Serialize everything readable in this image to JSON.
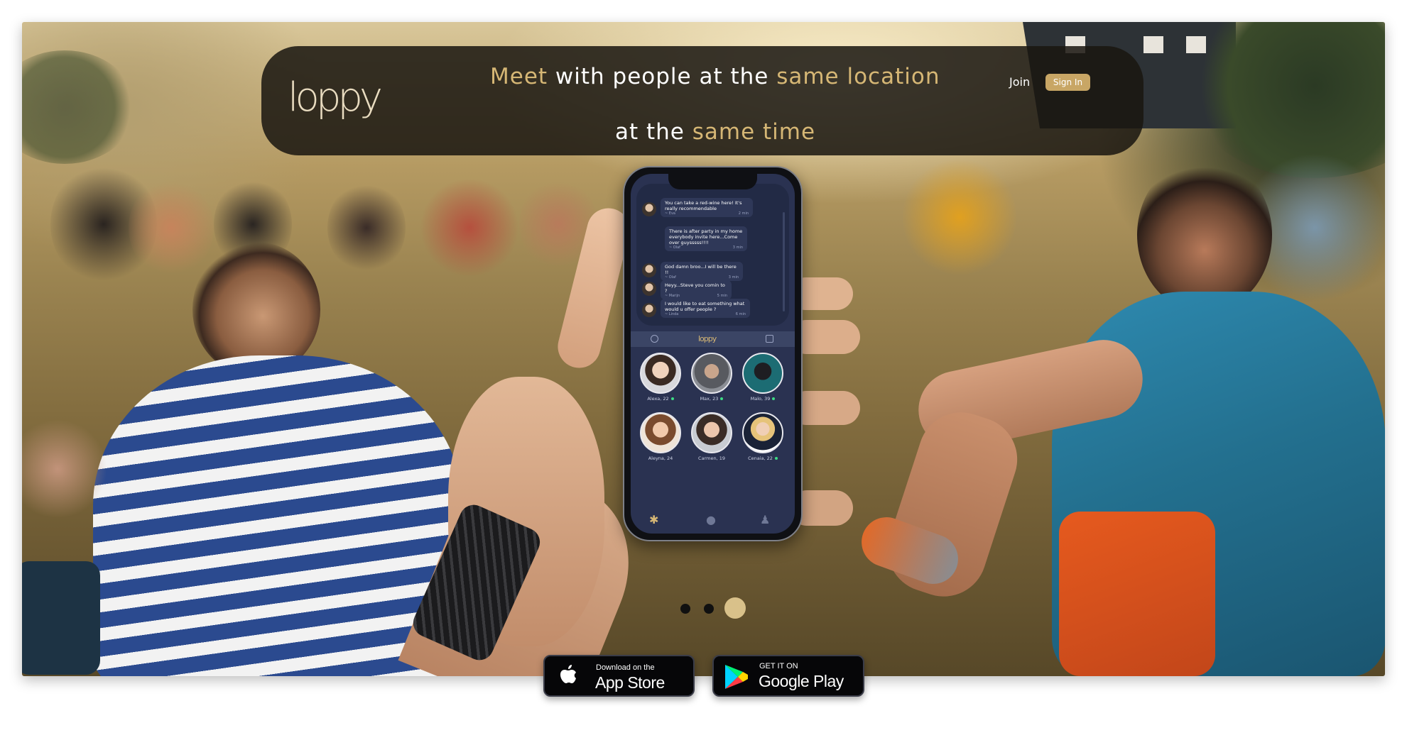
{
  "header": {
    "logo_text": "loppy",
    "tagline_line1": {
      "part1": "Meet",
      "part2": " with people at the ",
      "part3": "same location"
    },
    "tagline_line2": {
      "part1": "at the ",
      "part2": "same time"
    },
    "join_label": "Join",
    "signin_label": "Sign In"
  },
  "phone": {
    "app_logo": "loppy",
    "messages": [
      {
        "text": "You can take a red-wine here! It's really recommendable",
        "author": "~ Eva",
        "time": "2 min"
      },
      {
        "text": "There is after party in my home everybody invite here...Come over guysssss!!!!",
        "author": "~ Olaf",
        "time": "3 min"
      },
      {
        "text": "God damn broo...I will be there !!",
        "author": "~ Olaf",
        "time": "3 min"
      },
      {
        "text": "Heyy...Steve you comin to ?",
        "author": "~ Marijn",
        "time": "5 min"
      },
      {
        "text": "I would like to eat something what would u offer people ?",
        "author": "~ Linda",
        "time": "6 min"
      }
    ],
    "profiles": [
      {
        "name": "Alexa, 22",
        "online": true
      },
      {
        "name": "Max, 23",
        "online": true
      },
      {
        "name": "Malo, 39",
        "online": true
      },
      {
        "name": "Aleyna, 24",
        "online": false
      },
      {
        "name": "Carmen, 19",
        "online": false
      },
      {
        "name": "Cenaia, 22",
        "online": true
      }
    ],
    "tabs": [
      "hub-icon",
      "chat-icon",
      "profile-icon"
    ]
  },
  "carousel": {
    "slides": 3,
    "active_index": 2
  },
  "stores": {
    "appstore": {
      "small": "Download on the",
      "big": "App Store"
    },
    "googleplay": {
      "small": "GET IT ON",
      "big": "Google Play"
    }
  },
  "colors": {
    "gold": "#d6b775",
    "signin_bg": "#c8a665",
    "phone_screen": "#2a3251"
  }
}
